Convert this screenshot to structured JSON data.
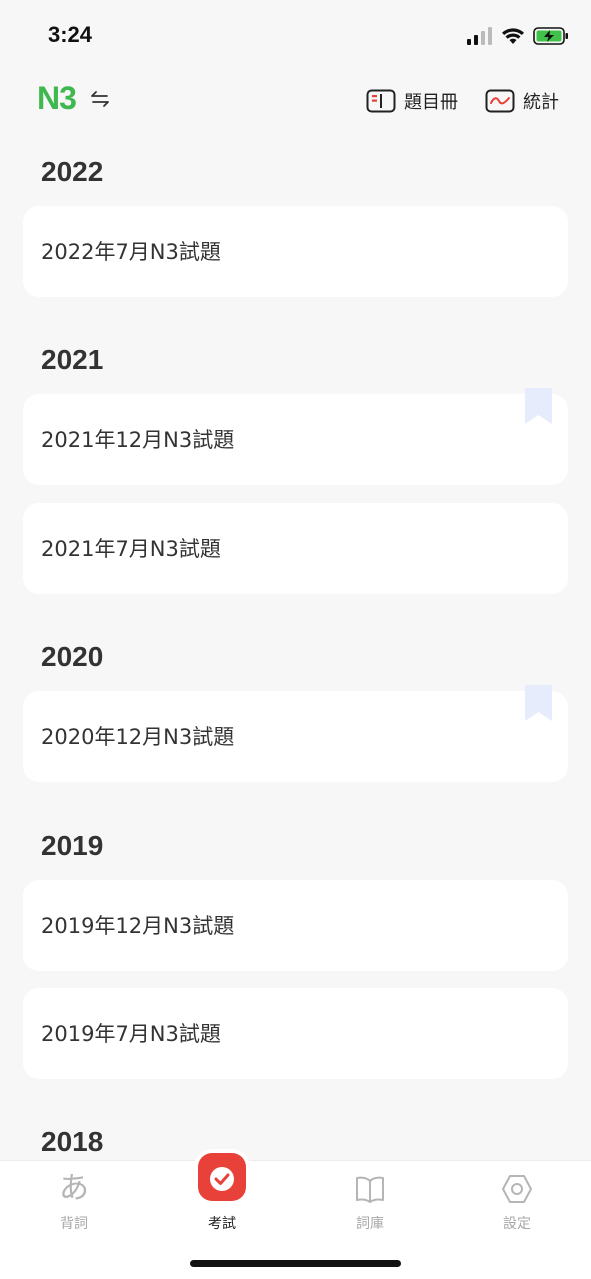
{
  "status": {
    "time": "3:24"
  },
  "header": {
    "level": "N3",
    "questions_label": "題目冊",
    "stats_label": "統計"
  },
  "colors": {
    "accent": "#3fb84f",
    "exam_tab": "#e8413a",
    "bookmark": "#e6ecfb"
  },
  "years": [
    {
      "year": "2022",
      "exams": [
        {
          "title": "2022年7月N3試題",
          "bookmarked": false
        }
      ]
    },
    {
      "year": "2021",
      "exams": [
        {
          "title": "2021年12月N3試題",
          "bookmarked": true
        },
        {
          "title": "2021年7月N3試題",
          "bookmarked": false
        }
      ]
    },
    {
      "year": "2020",
      "exams": [
        {
          "title": "2020年12月N3試題",
          "bookmarked": true
        }
      ]
    },
    {
      "year": "2019",
      "exams": [
        {
          "title": "2019年12月N3試題",
          "bookmarked": false
        },
        {
          "title": "2019年7月N3試題",
          "bookmarked": false
        }
      ]
    },
    {
      "year": "2018",
      "exams": []
    }
  ],
  "tabs": [
    {
      "label": "背詞",
      "icon": "hiragana-a-icon",
      "glyph": "あ"
    },
    {
      "label": "考試",
      "icon": "check-icon"
    },
    {
      "label": "詞庫",
      "icon": "book-icon"
    },
    {
      "label": "設定",
      "icon": "gear-icon"
    }
  ]
}
